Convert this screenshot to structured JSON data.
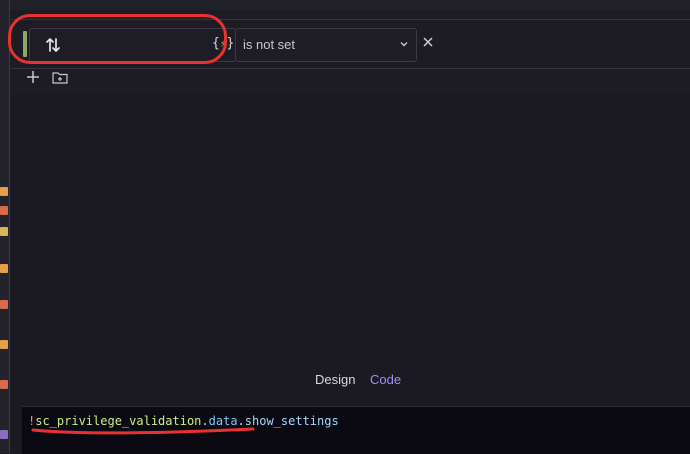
{
  "conditions": {
    "field": {
      "expression_icon": "{⚡}",
      "sort_icon": "sort-arrows-icon"
    },
    "operator": {
      "selected": "is not set"
    },
    "remove_icon": "close-icon",
    "toolbar": {
      "add_icon": "plus-icon",
      "add_group_icon": "folder-plus-icon"
    }
  },
  "mode_tabs": {
    "design": "Design",
    "code": "Code"
  },
  "code": {
    "tokens": [
      {
        "text": "!",
        "role": "bang"
      },
      {
        "text": "sc_privilege_validation",
        "role": "var"
      },
      {
        "text": ".",
        "role": "dot"
      },
      {
        "text": "data",
        "role": "prop"
      },
      {
        "text": ".",
        "role": "dot"
      },
      {
        "text": "show_settings",
        "role": "prop2"
      }
    ]
  },
  "colors": {
    "accent": "#8ea764",
    "code_tab": "#a58cf5",
    "annotation": "#e8322d"
  }
}
